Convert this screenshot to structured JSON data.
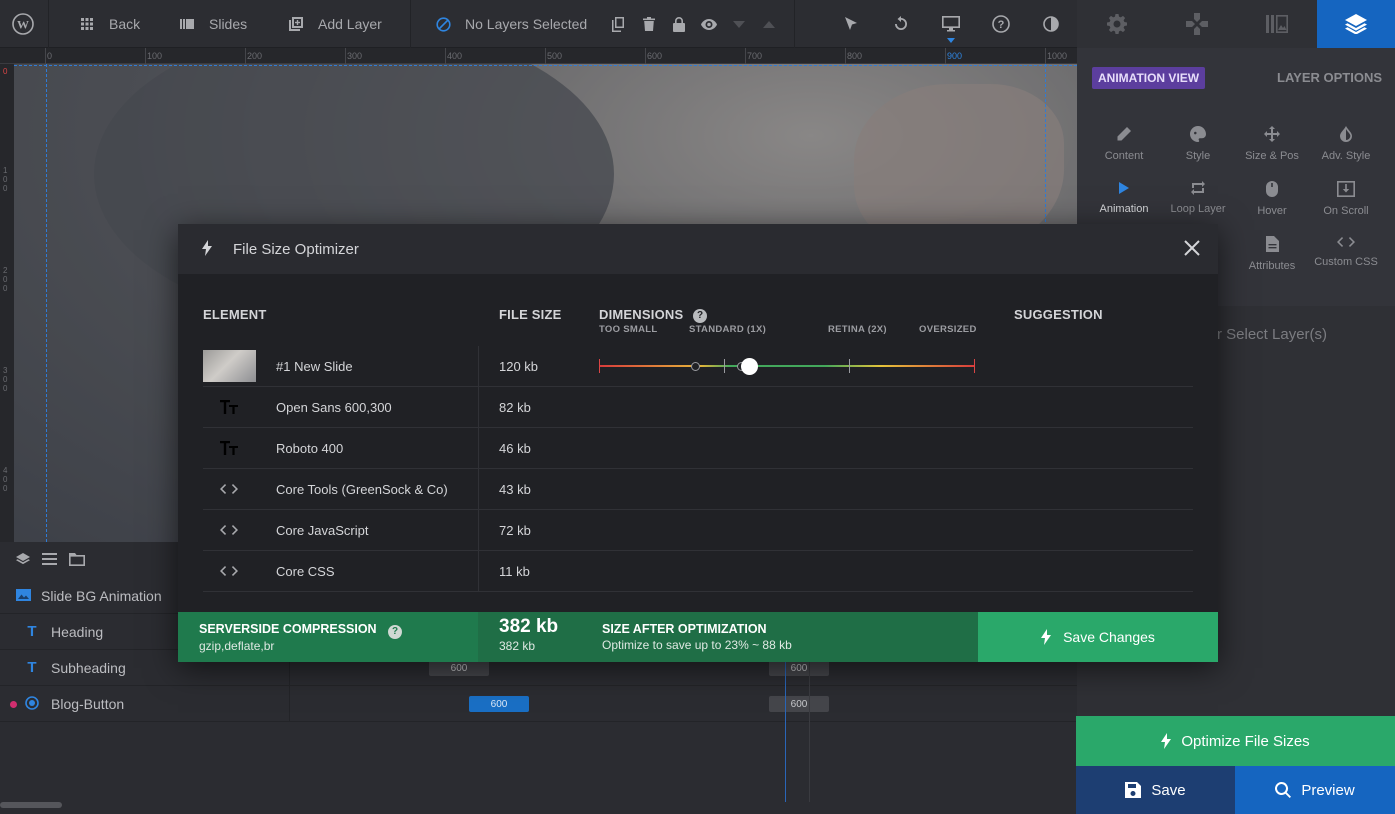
{
  "toolbar": {
    "back_label": "Back",
    "slides_label": "Slides",
    "add_layer_label": "Add Layer",
    "layer_status": "No Layers Selected"
  },
  "ruler": {
    "top_ticks": [
      "0",
      "100",
      "200",
      "300",
      "400",
      "500",
      "600",
      "700",
      "800",
      "900",
      "1000"
    ],
    "left_ticks": [
      "0",
      "1\n0\n0",
      "2\n0\n0",
      "3\n0\n0",
      "4\n0\n0"
    ]
  },
  "right_panel": {
    "animation_view": "ANIMATION VIEW",
    "layer_options": "LAYER OPTIONS",
    "cells": [
      "Content",
      "Style",
      "Size & Pos",
      "Adv. Style",
      "Animation",
      "Loop Layer",
      "Hover",
      "On Scroll",
      "Attributes",
      "Custom CSS"
    ],
    "select_layer_hint": "r Select Layer(s)",
    "optimize_label": "Optimize File Sizes",
    "save_label": "Save",
    "preview_label": "Preview"
  },
  "timeline": {
    "layers": [
      {
        "name": "Slide BG Animation"
      },
      {
        "name": "Heading"
      },
      {
        "name": "Subheading"
      },
      {
        "name": "Blog-Button"
      }
    ],
    "bars": [
      "600",
      "600",
      "600",
      "600"
    ]
  },
  "modal": {
    "title": "File Size Optimizer",
    "headers": {
      "element": "ELEMENT",
      "file_size": "FILE SIZE",
      "dimensions": "DIMENSIONS",
      "suggestion": "SUGGESTION"
    },
    "dimension_labels": [
      "TOO SMALL",
      "STANDARD (1X)",
      "RETINA (2X)",
      "OVERSIZED"
    ],
    "rows": [
      {
        "icon": "image-thumbnail",
        "name": "#1 New Slide",
        "size": "120 kb"
      },
      {
        "icon": "font-icon",
        "name": "Open Sans 600,300",
        "size": "82 kb"
      },
      {
        "icon": "font-icon",
        "name": "Roboto 400",
        "size": "46 kb"
      },
      {
        "icon": "code-icon",
        "name": "Core Tools (GreenSock & Co)",
        "size": "43 kb"
      },
      {
        "icon": "code-icon",
        "name": "Core JavaScript",
        "size": "72 kb"
      },
      {
        "icon": "code-icon",
        "name": "Core CSS",
        "size": "11 kb"
      }
    ],
    "footer": {
      "compression_label": "SERVERSIDE COMPRESSION",
      "compression_value": "gzip,deflate,br",
      "total_size": "382 kb",
      "total_size_sub": "382 kb",
      "after_label": "SIZE AFTER OPTIMIZATION",
      "after_sub": "Optimize to save up to 23% ~ 88 kb",
      "save_changes": "Save Changes"
    }
  },
  "colors": {
    "accent_blue": "#1565c0",
    "green": "#2aa86a",
    "purple_badge": "#5c3e9e"
  }
}
